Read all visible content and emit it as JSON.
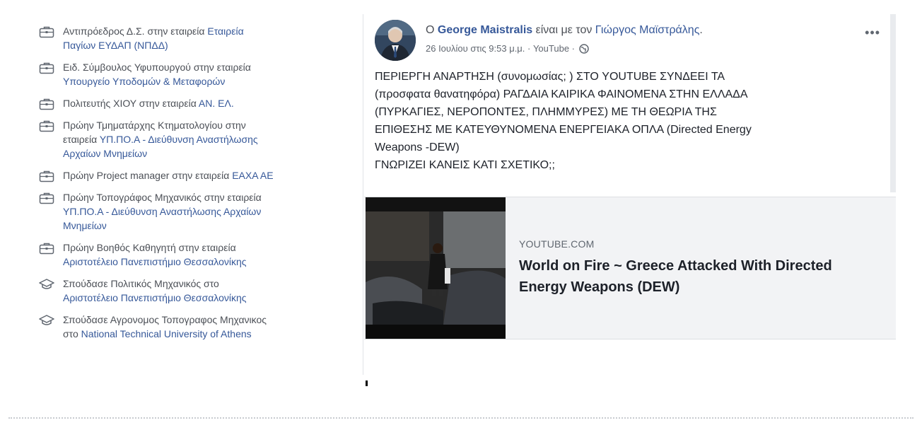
{
  "left_list": [
    {
      "icon": "briefcase-icon",
      "plain": "Αντιπρόεδρος Δ.Σ. στην εταιρεία ",
      "link": "Εταιρεία Παγίων ΕΥΔΑΠ (ΝΠΔΔ)",
      "line1": "Αντιπρόεδρος Δ.Σ. στην εταιρεία ",
      "line1link": "Εταιρεία",
      "line2link": "Παγίων ΕΥΔΑΠ (ΝΠΔΔ)"
    },
    {
      "icon": "briefcase-icon",
      "line1": "Ειδ. Σύμβουλος Υφυπουργού στην εταιρεία",
      "line1link": "",
      "line2link": "Υπουργείο Υποδομών & Μεταφορών"
    },
    {
      "icon": "briefcase-icon",
      "line1": "Πολιτευτής ΧΙΟΥ στην εταιρεία ",
      "line1link": "ΑΝ. ΕΛ.",
      "line2link": ""
    },
    {
      "icon": "briefcase-icon",
      "line1": "Πρώην Τμηματάρχης Κτηματολογίου στην",
      "line1link": "",
      "line2plain": "εταιρεία ",
      "line2link": "ΥΠ.ΠΟ.Α - Διεύθυνση Αναστήλωσης",
      "line3link": "Αρχαίων Μνημείων"
    },
    {
      "icon": "briefcase-icon",
      "line1": "Πρώην Project manager στην εταιρεία ",
      "line1link": "ΕΑΧΑ ΑΕ",
      "line2link": ""
    },
    {
      "icon": "briefcase-icon",
      "line1": "Πρώην Τοπογράφος Μηχανικός στην εταιρεία",
      "line1link": "",
      "line2link": "ΥΠ.ΠΟ.Α - Διεύθυνση Αναστήλωσης Αρχαίων",
      "line3link": "Μνημείων"
    },
    {
      "icon": "briefcase-icon",
      "line1": "Πρώην Βοηθός Καθηγητή στην εταιρεία",
      "line1link": "",
      "line2link": "Αριστοτέλειο Πανεπιστήμιο Θεσσαλονίκης"
    },
    {
      "icon": "graduation-cap-icon",
      "line1": "Σπούδασε Πολιτικός Μηχανικός στο",
      "line1link": "",
      "line2link": "Αριστοτέλειο Πανεπιστήμιο Θεσσαλονίκης"
    },
    {
      "icon": "graduation-cap-icon",
      "line1": "Σπούδασε Αγρονομος Τοπογραφος Μηχανικος",
      "line1link": "",
      "line2plain": "στο ",
      "line2link": "National Technical University of Athens"
    }
  ],
  "post": {
    "prefix": "Ο ",
    "author": "George Maistralis",
    "with_text": " είναι με τον ",
    "tagged": "Γιώργος Μαϊστράλης",
    "tagged_suffix": ".",
    "meta": "26 Ιουλίου στις 9:53 μ.μ. · YouTube · ",
    "menu": "•••",
    "body_lines": [
      "ΠΕΡΙΕΡΓΗ ΑΝΑΡΤΗΣΗ (συνομωσίας; ) ΣΤΟ YOUTUBE ΣΥΝΔΕΕΙ ΤΑ",
      "(προσφατα θανατηφόρα) ΡΑΓΔΑΙΑ ΚΑΙΡΙΚΑ ΦΑΙΝΟΜΕΝΑ ΣΤΗΝ ΕΛΛΑΔΑ",
      "(ΠΥΡΚΑΓΙΕΣ, ΝΕΡΟΠΟΝΤΕΣ, ΠΛΗΜΜΥΡΕΣ) ΜΕ ΤΗ ΘΕΩΡΙΑ ΤΗΣ",
      "ΕΠΙΘΕΣΗΣ ΜΕ ΚΑΤΕΥΘΥΝΟΜΕΝΑ ΕΝΕΡΓΕΙΑΚΑ ΟΠΛΑ (Directed Energy",
      "Weapons -DEW)",
      "ΓΝΩΡΙΖΕΙ ΚΑΝΕΙΣ ΚΑΤΙ ΣΧΕΤΙΚΟ;;"
    ],
    "link_domain": "YOUTUBE.COM",
    "link_title": "World on Fire ~ Greece Attacked With Directed Energy Weapons (DEW)"
  },
  "colors": {
    "link": "#365899",
    "preview_bg": "#f2f3f5"
  }
}
